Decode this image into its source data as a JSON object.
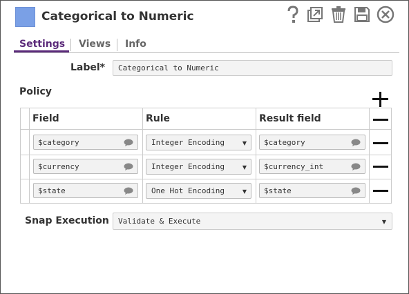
{
  "header": {
    "title": "Categorical to Numeric",
    "accent_color": "#7aa0e6",
    "toolbar_icons": [
      "help-icon",
      "export-icon",
      "delete-icon",
      "save-icon",
      "close-icon"
    ]
  },
  "tabs": [
    {
      "label": "Settings",
      "active": true
    },
    {
      "label": "Views",
      "active": false
    },
    {
      "label": "Info",
      "active": false
    }
  ],
  "label_field": {
    "label": "Label*",
    "value": "Categorical to Numeric"
  },
  "policy": {
    "section_label": "Policy",
    "columns": [
      "Field",
      "Rule",
      "Result field"
    ],
    "rows": [
      {
        "field": "$category",
        "rule": "Integer Encoding",
        "result": "$category"
      },
      {
        "field": "$currency",
        "rule": "Integer Encoding",
        "result": "$currency_int"
      },
      {
        "field": "$state",
        "rule": "One Hot Encoding",
        "result": "$state"
      }
    ]
  },
  "snap_execution": {
    "label": "Snap Execution",
    "value": "Validate & Execute"
  }
}
